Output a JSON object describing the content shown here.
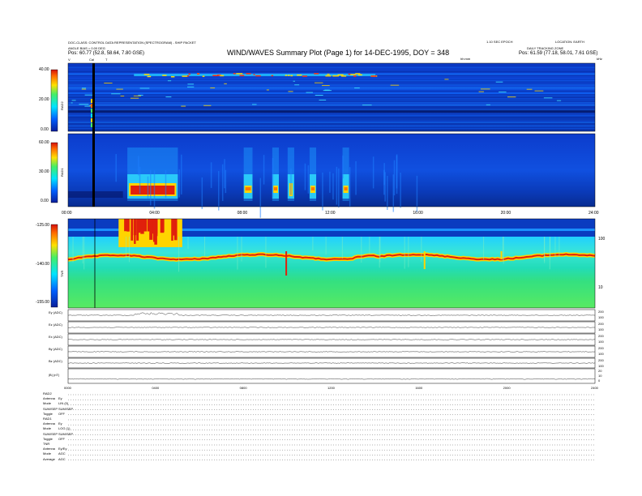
{
  "header": {
    "left_line1": "DOC-CLASS: CONTROL DATA REPRESENTATION (SPECTROGRAM) - SHIP PACKET",
    "left_line2": "ANGLE BIAS = 0.00 DEG",
    "left_line3_label": "Pos:",
    "left_line3_value": "60.77 (52.8, 58.64, 7.80 GSE)",
    "title": "WIND/WAVES Summary Plot (Page 1) for 14-DEC-1995, DOY = 348",
    "right_line1": "LOCATION: EARTH",
    "right_line2": "1.10 SEC EPOCH",
    "right_line3": "DAILY TRACKING ZONE",
    "right_line4_label": "Pos:",
    "right_line4_value": "61.59 (77.18, 58.01, 7.61 GSE)",
    "marker_labels": [
      "V",
      "Cal",
      "T"
    ],
    "time_units": "hh:mm",
    "khz_label": "kHz"
  },
  "panels": {
    "rad2_label": "RAD2",
    "rad2_ticks": [
      "40.00",
      "20.00",
      "0.00"
    ],
    "rad1_label": "RAD1",
    "rad1_ticks": [
      "60.00",
      "30.00",
      "0.00"
    ],
    "tnr_label": "TNR",
    "tnr_ticks": [
      "-125.00",
      "-140.00",
      "-155.00"
    ],
    "tnr_right_ticks": [
      "100",
      "10"
    ],
    "x_ticks_top": [
      "00:00",
      "04:00",
      "08:00",
      "12:00",
      "16:00",
      "20:00",
      "24:00"
    ],
    "x_ticks_bottom": [
      "0000",
      "0400",
      "0800",
      "1200",
      "1600",
      "2000",
      "2400"
    ],
    "line_panels": [
      {
        "label": "Ey (ADC)",
        "ticks": [
          "200",
          "100"
        ]
      },
      {
        "label": "Ez (ADC)",
        "ticks": [
          "200",
          "100"
        ]
      },
      {
        "label": "Ex (ADC)",
        "ticks": [
          "200",
          "100"
        ]
      },
      {
        "label": "By (ADC)",
        "ticks": [
          "200",
          "100"
        ]
      },
      {
        "label": "Bz (ADC)",
        "ticks": [
          "200",
          "100"
        ]
      },
      {
        "label": "|B| (nT)",
        "ticks": [
          "20",
          "10",
          "0"
        ]
      }
    ]
  },
  "footer": {
    "rows": [
      [
        "RAD2",
        ""
      ],
      [
        "Antenna",
        "Ey"
      ],
      [
        "Mode",
        "LIN (0)"
      ],
      [
        "SUM/SEP",
        "SUM/SEP"
      ],
      [
        "Toggle",
        "OFF"
      ],
      [
        "RAD1",
        ""
      ],
      [
        "Antenna",
        "Ey"
      ],
      [
        "Mode",
        "LOG (1)"
      ],
      [
        "SUM/SEP",
        "SUM/SEP"
      ],
      [
        "Toggle",
        "OFF"
      ],
      [
        "TNR",
        ""
      ],
      [
        "Antenna",
        "Ey/Ey"
      ],
      [
        "Mode",
        "AGC"
      ],
      [
        "Average",
        "AGC"
      ]
    ]
  },
  "colors": {
    "background_spectrum": "#0a2fa8",
    "cool": "#00d2ff",
    "warm": "#ffd400",
    "hot": "#e0200c",
    "green": "#22d36a"
  },
  "chart_data": {
    "type": "heatmap",
    "title": "WIND/WAVES Summary Plot (Page 1) for 14-DEC-1995, DOY = 348",
    "x_range_hours": [
      0,
      24
    ],
    "panels": [
      {
        "name": "RAD2",
        "ylim": [
          0,
          40
        ],
        "description_level": "mostly low intensity with banded emission near 35-40"
      },
      {
        "name": "RAD1",
        "ylim": [
          0,
          60
        ],
        "bursts": [
          {
            "start_hour": 2.7,
            "end_hour": 5.0,
            "level": "high"
          },
          {
            "start_hour": 8.0,
            "end_hour": 8.4,
            "level": "medium"
          },
          {
            "start_hour": 9.3,
            "end_hour": 9.6,
            "level": "medium"
          },
          {
            "start_hour": 10.0,
            "end_hour": 10.3,
            "level": "high"
          },
          {
            "start_hour": 11.0,
            "end_hour": 11.3,
            "level": "medium"
          },
          {
            "start_hour": 12.5,
            "end_hour": 12.8,
            "level": "medium"
          }
        ]
      },
      {
        "name": "TNR",
        "ylim": [
          -155,
          -125
        ],
        "plasma_line_level": -138
      }
    ]
  }
}
